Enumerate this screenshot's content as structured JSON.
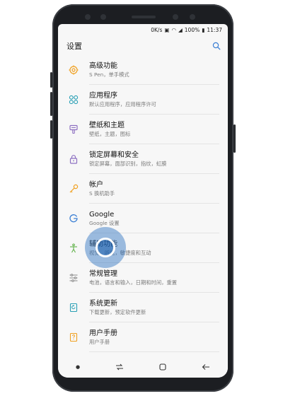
{
  "status": {
    "speed": "0K/s",
    "battery": "100%",
    "time": "11:37"
  },
  "appbar": {
    "title": "设置"
  },
  "items": [
    {
      "title": "高级功能",
      "subtitle": "S Pen，单手模式",
      "icon": "advanced-features-icon"
    },
    {
      "title": "应用程序",
      "subtitle": "默认应用程序，应用程序许可",
      "icon": "apps-icon"
    },
    {
      "title": "壁纸和主题",
      "subtitle": "壁纸，主题，图标",
      "icon": "wallpaper-icon"
    },
    {
      "title": "锁定屏幕和安全",
      "subtitle": "锁定屏幕，面部识别，指纹，虹膜",
      "icon": "lock-icon"
    },
    {
      "title": "帐户",
      "subtitle": "S 换机助手",
      "icon": "key-icon"
    },
    {
      "title": "Google",
      "subtitle": "Google 设置",
      "icon": "google-icon"
    },
    {
      "title": "辅助功能",
      "subtitle": "视觉，听觉，敏捷度和互动",
      "icon": "accessibility-icon"
    },
    {
      "title": "常规管理",
      "subtitle": "电池，语言和输入，日期和时间，重置",
      "icon": "sliders-icon"
    },
    {
      "title": "系统更新",
      "subtitle": "下载更新，预定软件更新",
      "icon": "system-update-icon"
    },
    {
      "title": "用户手册",
      "subtitle": "用户手册",
      "icon": "manual-icon"
    }
  ],
  "colors": {
    "accent_orange": "#f0a020",
    "accent_blue": "#3b7fd4",
    "accent_purple": "#8d6fc1",
    "accent_green": "#62b24a",
    "accent_teal": "#2aa0b5"
  }
}
